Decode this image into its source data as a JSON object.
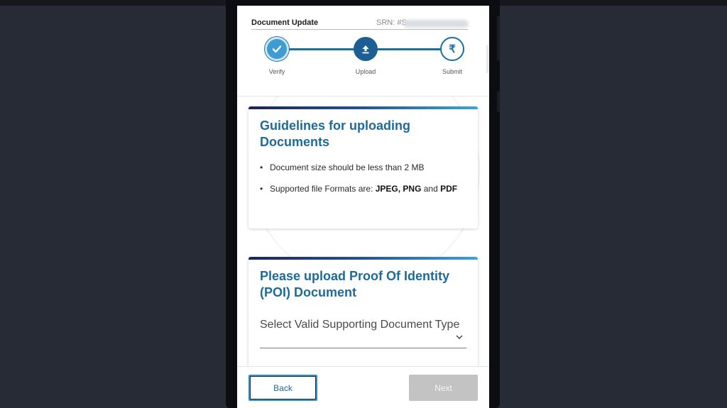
{
  "header": {
    "title": "Document Update",
    "srn_label": "SRN: #S"
  },
  "stepper": {
    "steps": [
      {
        "label": "Verify",
        "state": "completed",
        "icon": "check-icon"
      },
      {
        "label": "Upload",
        "state": "active",
        "icon": "upload-icon"
      },
      {
        "label": "Submit",
        "state": "pending",
        "icon": "rupee-icon",
        "glyph": "₹"
      }
    ]
  },
  "guidelines": {
    "title": "Guidelines for uploading Documents",
    "items": [
      {
        "text": "Document size should be less than 2 MB"
      },
      {
        "prefix": "Supported file Formats are: ",
        "bold1": "JPEG, PNG",
        "mid": " and ",
        "bold2": "PDF"
      }
    ]
  },
  "poi": {
    "title": "Please upload Proof Of Identity (POI) Document",
    "select_label": "Select Valid Supporting Document Type"
  },
  "footer": {
    "back_label": "Back",
    "next_label": "Next"
  },
  "colors": {
    "accent": "#1e6a99",
    "step_active": "#1b5f95",
    "step_done": "#3d9dd3",
    "disabled_button": "#c3c3c3",
    "background": "#272b36"
  }
}
